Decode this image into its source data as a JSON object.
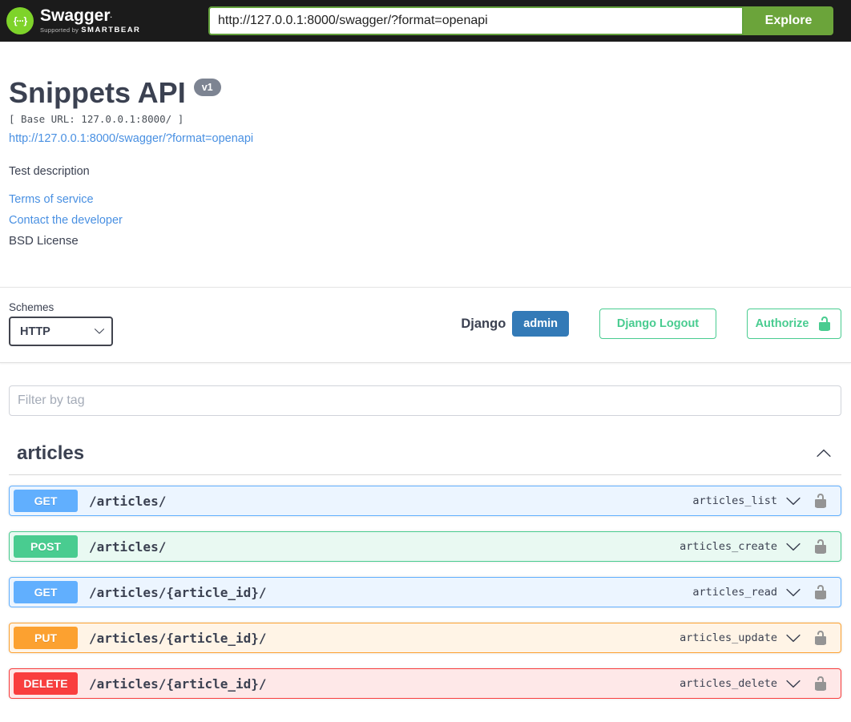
{
  "topbar": {
    "logo_text": "Swagger",
    "logo_tm": ".",
    "supported_by": "Supported by",
    "smartbear": "SMARTBEAR",
    "logo_glyph": "{···}",
    "url_value": "http://127.0.0.1:8000/swagger/?format=openapi",
    "explore_label": "Explore"
  },
  "info": {
    "title": "Snippets API",
    "version_badge": "v1",
    "base_url": "[ Base URL: 127.0.0.1:8000/ ]",
    "spec_link": "http://127.0.0.1:8000/swagger/?format=openapi",
    "description": "Test description",
    "terms_link": "Terms of service",
    "contact_link": "Contact the developer",
    "license_link": "BSD License"
  },
  "scheme": {
    "label": "Schemes",
    "selected": "HTTP",
    "django_label": "Django",
    "admin_badge": "admin",
    "logout_button": "Django Logout",
    "authorize_button": "Authorize"
  },
  "filter": {
    "placeholder": "Filter by tag"
  },
  "section": {
    "title": "articles"
  },
  "operations": [
    {
      "method": "GET",
      "path": "/articles/",
      "op_id": "articles_list"
    },
    {
      "method": "POST",
      "path": "/articles/",
      "op_id": "articles_create"
    },
    {
      "method": "GET",
      "path": "/articles/{article_id}/",
      "op_id": "articles_read"
    },
    {
      "method": "PUT",
      "path": "/articles/{article_id}/",
      "op_id": "articles_update"
    },
    {
      "method": "DELETE",
      "path": "/articles/{article_id}/",
      "op_id": "articles_delete"
    }
  ],
  "colors": {
    "get": "#61affe",
    "post": "#49cc90",
    "put": "#fca130",
    "delete": "#f93e3e",
    "authorize_green": "#49cc90",
    "admin_blue": "#337ab7",
    "link_blue": "#4990e2",
    "topbar_bg": "#1b1b1b",
    "explore_green": "#6ba43a",
    "logo_green": "#7ed32a",
    "version_badge_bg": "#7d8492",
    "lock_gray": "#949494",
    "text_main": "#3b4151"
  }
}
